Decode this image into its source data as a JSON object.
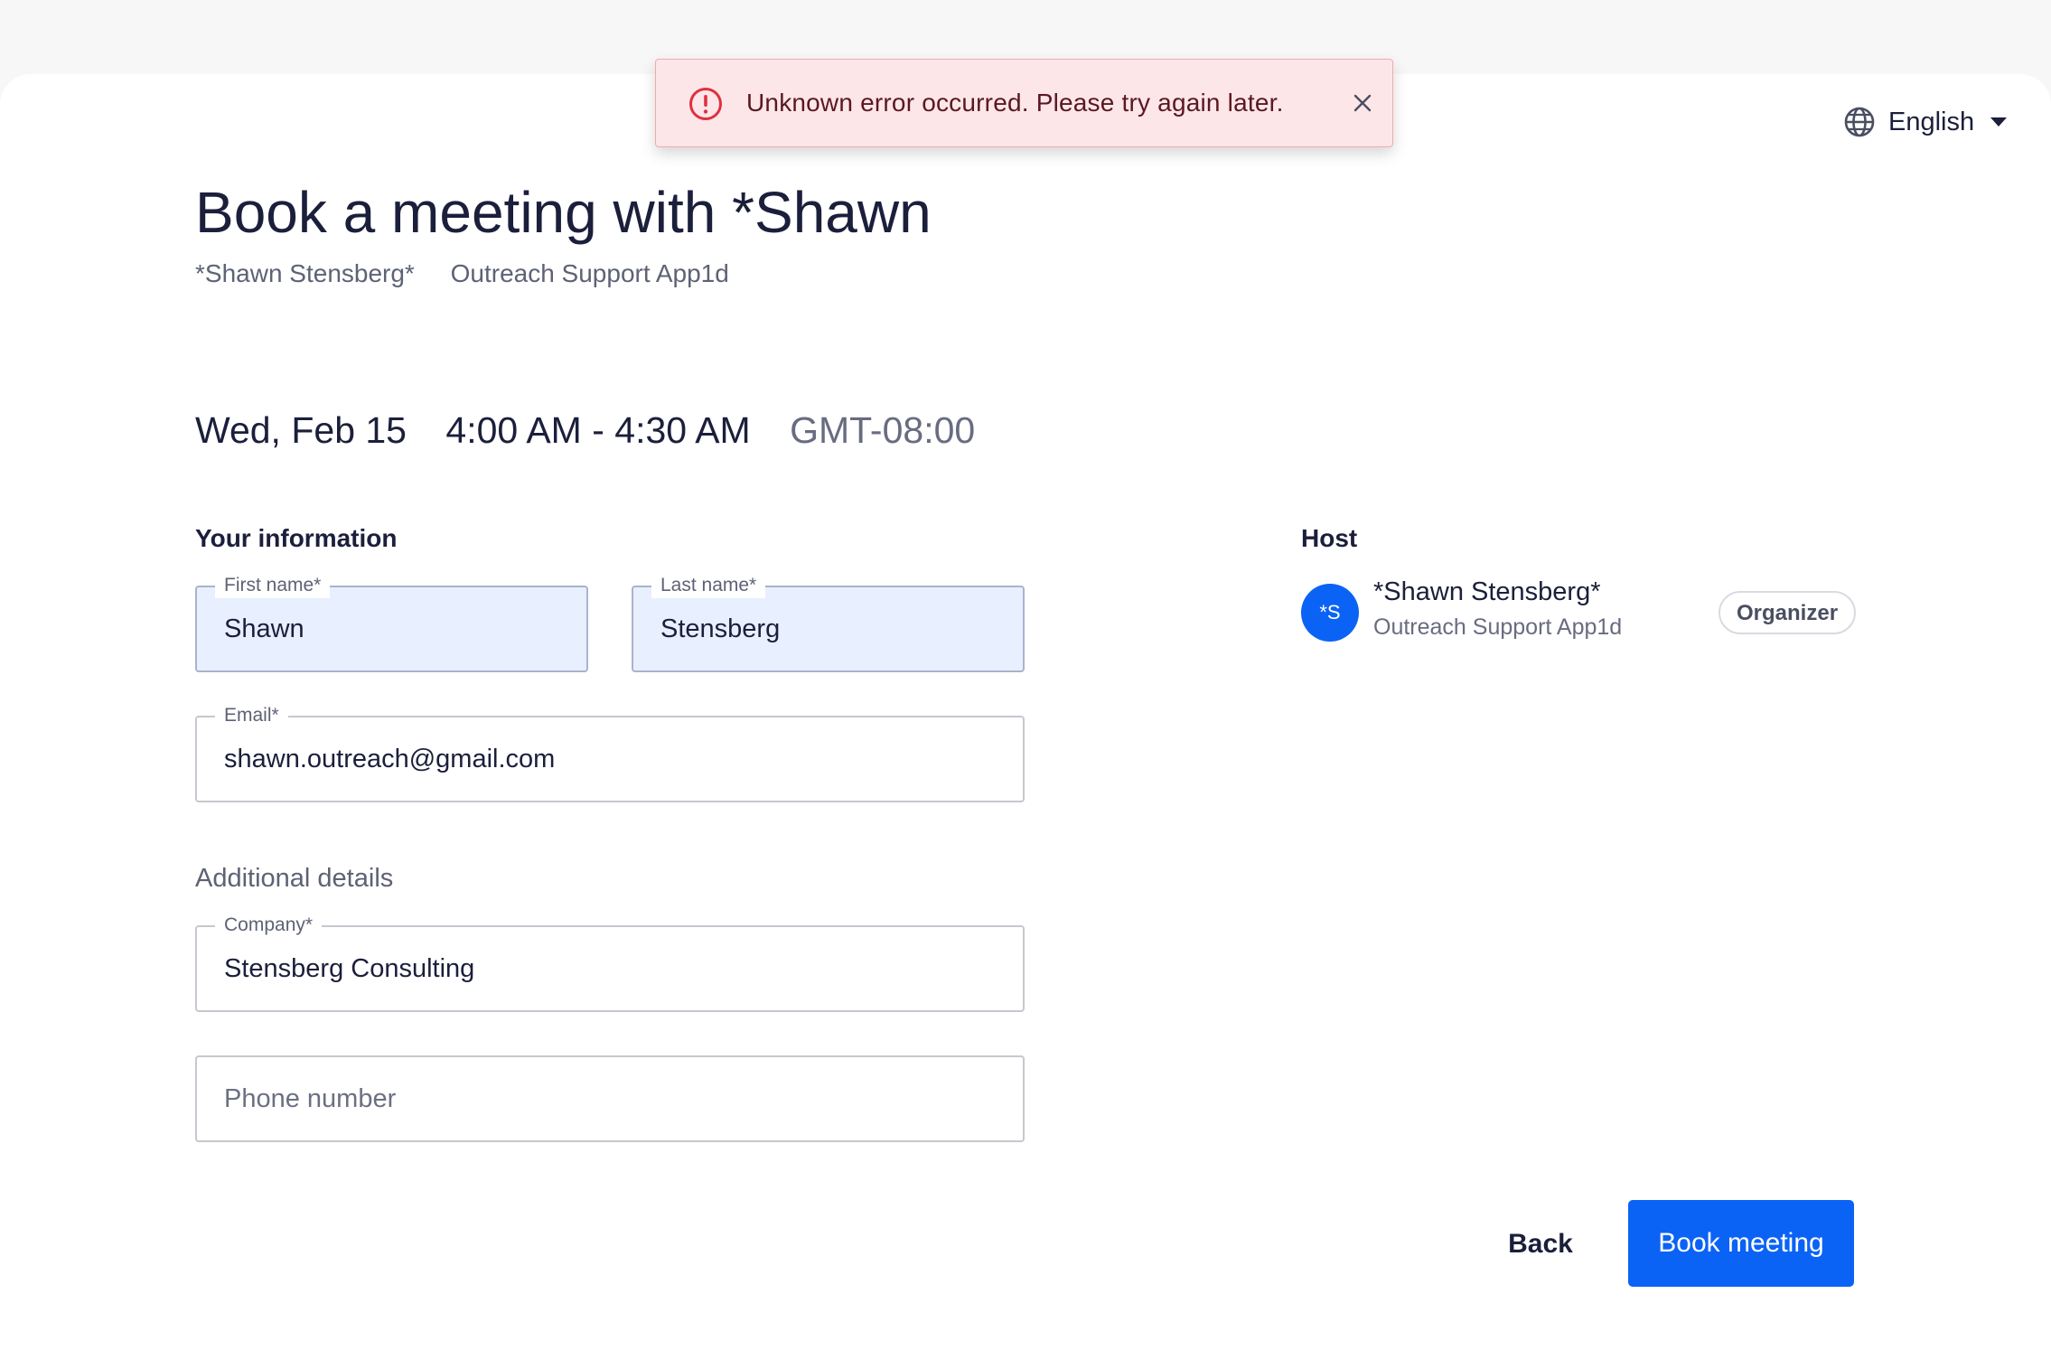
{
  "toast": {
    "message": "Unknown error occurred. Please try again later.",
    "close_icon": "close-icon",
    "error_icon": "alert-circle-icon"
  },
  "language": {
    "label": "English",
    "icon": "globe-icon"
  },
  "header": {
    "title": "Book a meeting with *Shawn",
    "host_name": "*Shawn Stensberg*",
    "organization": "Outreach Support App1d"
  },
  "meeting": {
    "date": "Wed, Feb 15",
    "time": "4:00 AM - 4:30 AM",
    "timezone": "GMT-08:00"
  },
  "form": {
    "section_title": "Your information",
    "first_name": {
      "label": "First name*",
      "value": "Shawn"
    },
    "last_name": {
      "label": "Last name*",
      "value": "Stensberg"
    },
    "email": {
      "label": "Email*",
      "value": "shawn.outreach@gmail.com"
    },
    "additional_title": "Additional details",
    "company": {
      "label": "Company*",
      "value": "Stensberg Consulting"
    },
    "phone": {
      "placeholder": "Phone number",
      "value": ""
    }
  },
  "host": {
    "section_title": "Host",
    "avatar_initials": "*S",
    "name": "*Shawn Stensberg*",
    "organization": "Outreach Support App1d",
    "role_badge": "Organizer"
  },
  "actions": {
    "back_label": "Back",
    "book_label": "Book meeting"
  },
  "colors": {
    "primary": "#0b63f6",
    "toast_background": "#fde6e8",
    "error": "#e0303f",
    "filled_field": "#e8efff"
  }
}
